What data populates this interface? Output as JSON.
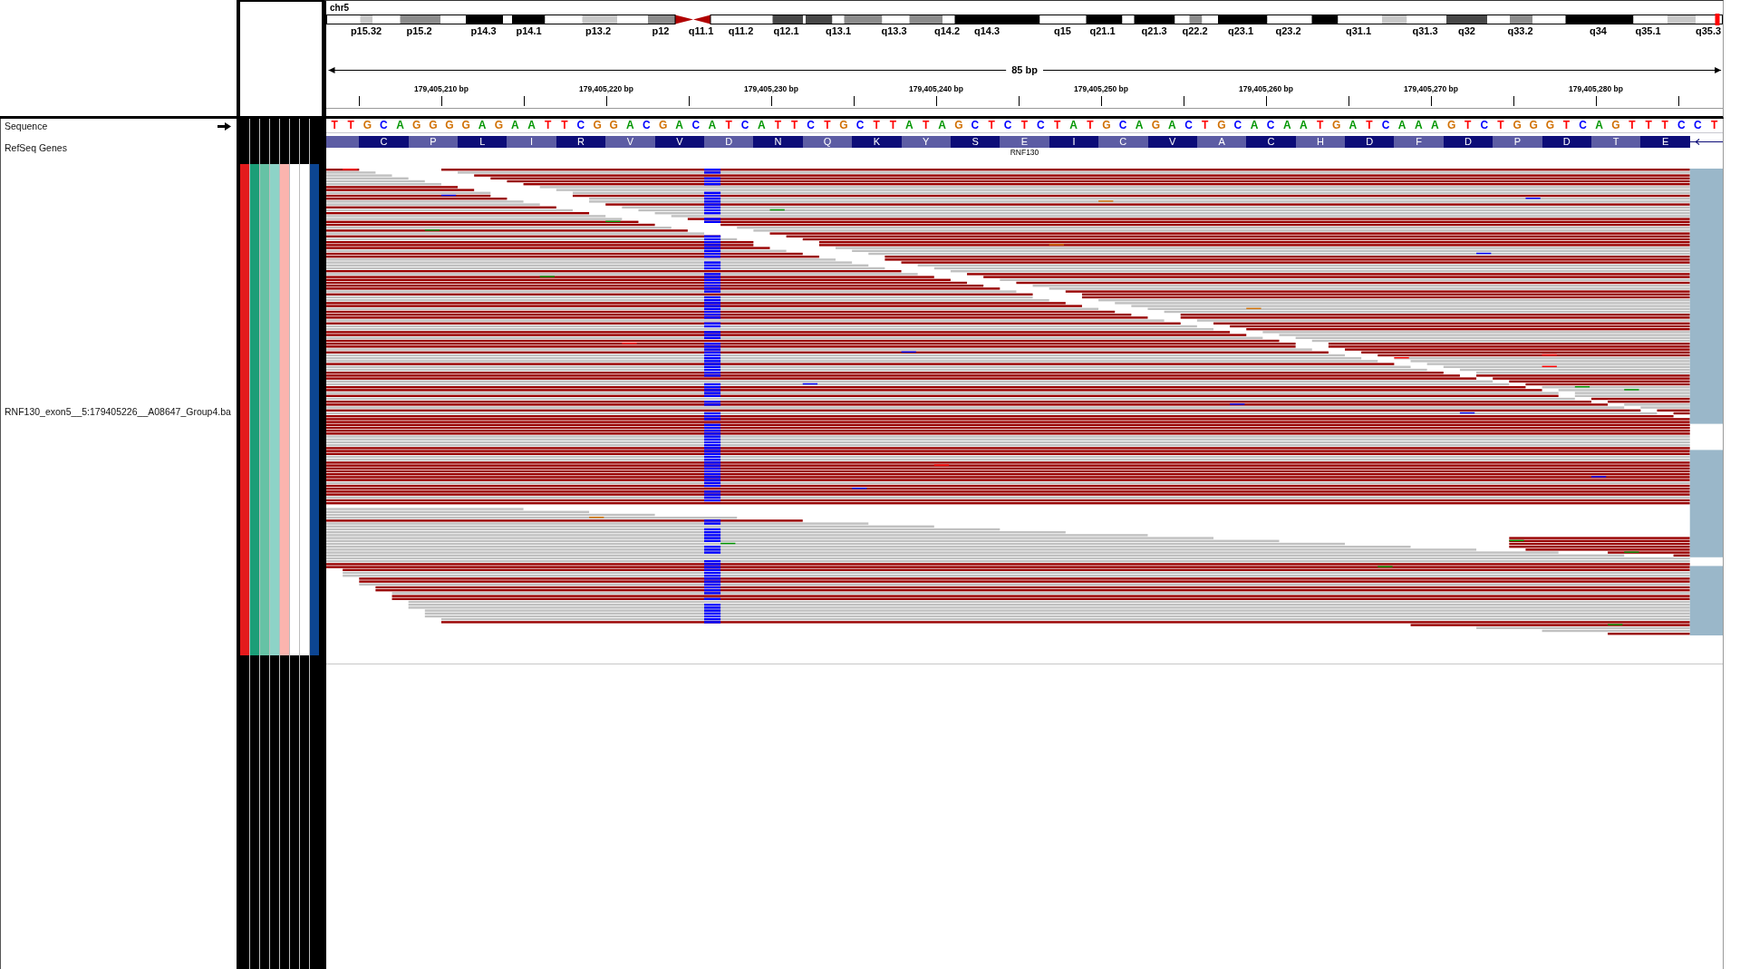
{
  "ideogram": {
    "chromosome": "chr5",
    "band_labels": [
      "p15.32",
      "p15.2",
      "p14.3",
      "p14.1",
      "p13.2",
      "p12",
      "q11.1",
      "q11.2",
      "q12.1",
      "q13.1",
      "q13.3",
      "q14.2",
      "q14.3",
      "q15",
      "q21.1",
      "q21.3",
      "q22.2",
      "q23.1",
      "q23.2",
      "q31.1",
      "q31.3",
      "q32",
      "q33.2",
      "q34",
      "q35.1",
      "q35.3"
    ]
  },
  "ruler": {
    "span": "85 bp",
    "tick_labels": [
      "179,405,210 bp",
      "179,405,220 bp",
      "179,405,230 bp",
      "179,405,240 bp",
      "179,405,250 bp",
      "179,405,260 bp",
      "179,405,270 bp",
      "179,405,280 bp"
    ]
  },
  "tracks": [
    {
      "kind": "sequence",
      "name": "Sequence",
      "reverse_strand": false,
      "bases": [
        {
          "base": "T",
          "color": "#ff0000"
        },
        {
          "base": "T",
          "color": "#ff0000"
        },
        {
          "base": "G",
          "color": "#d17105"
        },
        {
          "base": "C",
          "color": "#0000ff"
        },
        {
          "base": "A",
          "color": "#009600"
        },
        {
          "base": "G",
          "color": "#d17105"
        },
        {
          "base": "G",
          "color": "#d17105"
        },
        {
          "base": "G",
          "color": "#d17105"
        },
        {
          "base": "G",
          "color": "#d17105"
        },
        {
          "base": "A",
          "color": "#009600"
        },
        {
          "base": "G",
          "color": "#d17105"
        },
        {
          "base": "A",
          "color": "#009600"
        },
        {
          "base": "A",
          "color": "#009600"
        },
        {
          "base": "T",
          "color": "#ff0000"
        },
        {
          "base": "T",
          "color": "#ff0000"
        },
        {
          "base": "C",
          "color": "#0000ff"
        },
        {
          "base": "G",
          "color": "#d17105"
        },
        {
          "base": "G",
          "color": "#d17105"
        },
        {
          "base": "A",
          "color": "#009600"
        },
        {
          "base": "C",
          "color": "#0000ff"
        },
        {
          "base": "G",
          "color": "#d17105"
        },
        {
          "base": "A",
          "color": "#009600"
        },
        {
          "base": "C",
          "color": "#0000ff"
        },
        {
          "base": "A",
          "color": "#009600"
        },
        {
          "base": "T",
          "color": "#ff0000"
        },
        {
          "base": "C",
          "color": "#0000ff"
        },
        {
          "base": "A",
          "color": "#009600"
        },
        {
          "base": "T",
          "color": "#ff0000"
        },
        {
          "base": "T",
          "color": "#ff0000"
        },
        {
          "base": "C",
          "color": "#0000ff"
        },
        {
          "base": "T",
          "color": "#ff0000"
        },
        {
          "base": "G",
          "color": "#d17105"
        },
        {
          "base": "C",
          "color": "#0000ff"
        },
        {
          "base": "T",
          "color": "#ff0000"
        },
        {
          "base": "T",
          "color": "#ff0000"
        },
        {
          "base": "A",
          "color": "#009600"
        },
        {
          "base": "T",
          "color": "#ff0000"
        },
        {
          "base": "A",
          "color": "#009600"
        },
        {
          "base": "G",
          "color": "#d17105"
        },
        {
          "base": "C",
          "color": "#0000ff"
        },
        {
          "base": "T",
          "color": "#ff0000"
        },
        {
          "base": "C",
          "color": "#0000ff"
        },
        {
          "base": "T",
          "color": "#ff0000"
        },
        {
          "base": "C",
          "color": "#0000ff"
        },
        {
          "base": "T",
          "color": "#ff0000"
        },
        {
          "base": "A",
          "color": "#009600"
        },
        {
          "base": "T",
          "color": "#ff0000"
        },
        {
          "base": "G",
          "color": "#d17105"
        },
        {
          "base": "C",
          "color": "#0000ff"
        },
        {
          "base": "A",
          "color": "#009600"
        },
        {
          "base": "G",
          "color": "#d17105"
        },
        {
          "base": "A",
          "color": "#009600"
        },
        {
          "base": "C",
          "color": "#0000ff"
        },
        {
          "base": "T",
          "color": "#ff0000"
        },
        {
          "base": "G",
          "color": "#d17105"
        },
        {
          "base": "C",
          "color": "#0000ff"
        },
        {
          "base": "A",
          "color": "#009600"
        },
        {
          "base": "C",
          "color": "#0000ff"
        },
        {
          "base": "A",
          "color": "#009600"
        },
        {
          "base": "A",
          "color": "#009600"
        },
        {
          "base": "T",
          "color": "#ff0000"
        },
        {
          "base": "G",
          "color": "#d17105"
        },
        {
          "base": "A",
          "color": "#009600"
        },
        {
          "base": "T",
          "color": "#ff0000"
        },
        {
          "base": "C",
          "color": "#0000ff"
        },
        {
          "base": "A",
          "color": "#009600"
        },
        {
          "base": "A",
          "color": "#009600"
        },
        {
          "base": "A",
          "color": "#009600"
        },
        {
          "base": "G",
          "color": "#d17105"
        },
        {
          "base": "T",
          "color": "#ff0000"
        },
        {
          "base": "C",
          "color": "#0000ff"
        },
        {
          "base": "T",
          "color": "#ff0000"
        },
        {
          "base": "G",
          "color": "#d17105"
        },
        {
          "base": "G",
          "color": "#d17105"
        },
        {
          "base": "G",
          "color": "#d17105"
        },
        {
          "base": "T",
          "color": "#ff0000"
        },
        {
          "base": "C",
          "color": "#0000ff"
        },
        {
          "base": "A",
          "color": "#009600"
        },
        {
          "base": "G",
          "color": "#d17105"
        },
        {
          "base": "T",
          "color": "#ff0000"
        },
        {
          "base": "T",
          "color": "#ff0000"
        },
        {
          "base": "T",
          "color": "#ff0000"
        },
        {
          "base": "C",
          "color": "#0000ff"
        },
        {
          "base": "C",
          "color": "#0000ff"
        },
        {
          "base": "T",
          "color": "#ff0000"
        }
      ]
    },
    {
      "kind": "gene",
      "name": "RefSeq Genes",
      "gene_name": "RNF130",
      "reverse_strand": true,
      "amino_acids": [
        "C",
        "P",
        "L",
        "I",
        "R",
        "V",
        "V",
        "D",
        "N",
        "Q",
        "K",
        "Y",
        "S",
        "E",
        "I",
        "C",
        "V",
        "A",
        "C",
        "H",
        "D",
        "F",
        "D",
        "P",
        "D",
        "T",
        "E"
      ]
    },
    {
      "kind": "alignment",
      "name": "RNF130_exon5__5:179405226__A08647_Group4.ba",
      "attributes": [
        {
          "color": "#e41a1c"
        },
        {
          "color": "#1b9e77"
        },
        {
          "color": "#66c2a5"
        },
        {
          "color": "#8dd3c7"
        },
        {
          "color": "#fbb4ae"
        },
        {
          "color": "#ffffff"
        },
        {
          "color": "#ffffff"
        },
        {
          "color": "#0c4592"
        }
      ]
    }
  ]
}
